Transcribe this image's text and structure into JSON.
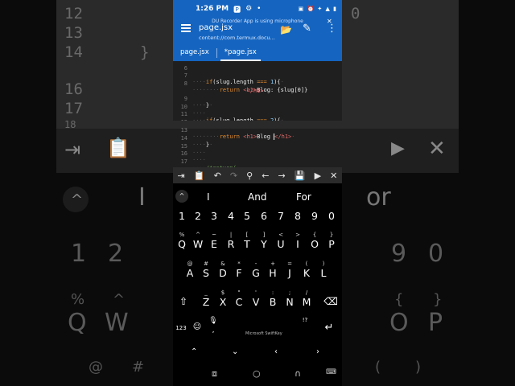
{
  "background": {
    "left_lines": [
      "12",
      "13",
      "14",
      "16",
      "17",
      "18"
    ],
    "right_lines": [
      "0"
    ],
    "big_row_left": [
      "1",
      "2"
    ],
    "big_row_right": [
      "9",
      "0"
    ],
    "big_row2_left": [
      "Q",
      "W"
    ],
    "big_row2_right": [
      "O",
      "P"
    ],
    "sym_left": [
      "%",
      "^"
    ],
    "sym_right": [
      "{",
      "}"
    ],
    "at_left": [
      "@",
      "#"
    ],
    "paren_right": [
      "(",
      ")"
    ],
    "suggest_i": "I",
    "suggest_or": "or"
  },
  "statusbar": {
    "time": "1:26 PM",
    "right": "▣ ⏰ ✦ ▲ ▮"
  },
  "app": {
    "recording_banner": "DU Recorder App is using microphone",
    "title": "page.jsx",
    "subtitle": "content://com.termux.docu...",
    "tabs": [
      "page.jsx",
      "*page.jsx"
    ],
    "active_tab": 1
  },
  "editor": {
    "lines": [
      {
        "n": "6",
        "html": ""
      },
      {
        "n": "7",
        "html": "if(slug.length === 1){"
      },
      {
        "n": "8",
        "html": "return <h1>Blog: {slug[0]}"
      },
      {
        "n": "",
        "html": "</h1>"
      },
      {
        "n": "9",
        "html": "}"
      },
      {
        "n": "10",
        "html": ""
      },
      {
        "n": "11",
        "html": "if(slug.length === 2){"
      },
      {
        "n": "12",
        "html": ""
      },
      {
        "n": "13",
        "html": "return <h1>Blog </h1>"
      },
      {
        "n": "14",
        "html": "}"
      },
      {
        "n": "15",
        "html": ""
      },
      {
        "n": "16",
        "html": ""
      },
      {
        "n": "17",
        "html": "/*return("
      },
      {
        "n": "18",
        "html": "<div>"
      }
    ]
  },
  "keyboard": {
    "suggestions": [
      "I",
      "And",
      "For"
    ],
    "numbers": [
      "1",
      "2",
      "3",
      "4",
      "5",
      "6",
      "7",
      "8",
      "9",
      "0"
    ],
    "row1": [
      {
        "h": "%",
        "k": "Q"
      },
      {
        "h": "^",
        "k": "W"
      },
      {
        "h": "~",
        "k": "E"
      },
      {
        "h": "|",
        "k": "R"
      },
      {
        "h": "[",
        "k": "T"
      },
      {
        "h": "]",
        "k": "Y"
      },
      {
        "h": "<",
        "k": "U"
      },
      {
        "h": ">",
        "k": "I"
      },
      {
        "h": "{",
        "k": "O"
      },
      {
        "h": "}",
        "k": "P"
      }
    ],
    "row2": [
      {
        "h": "@",
        "k": "A"
      },
      {
        "h": "#",
        "k": "S"
      },
      {
        "h": "&",
        "k": "D"
      },
      {
        "h": "*",
        "k": "F"
      },
      {
        "h": "-",
        "k": "G"
      },
      {
        "h": "+",
        "k": "H"
      },
      {
        "h": "=",
        "k": "J"
      },
      {
        "h": "(",
        "k": "K"
      },
      {
        "h": ")",
        "k": "L"
      }
    ],
    "row3": [
      {
        "h": "_",
        "k": "Z"
      },
      {
        "h": "$",
        "k": "X"
      },
      {
        "h": "\"",
        "k": "C"
      },
      {
        "h": "'",
        "k": "V"
      },
      {
        "h": ":",
        "k": "B"
      },
      {
        "h": ";",
        "k": "N"
      },
      {
        "h": "/",
        "k": "M"
      }
    ],
    "mode_label": "123",
    "space_label": "Microsoft SwiftKey",
    "punct_hint": "!?",
    "punct": ","
  }
}
